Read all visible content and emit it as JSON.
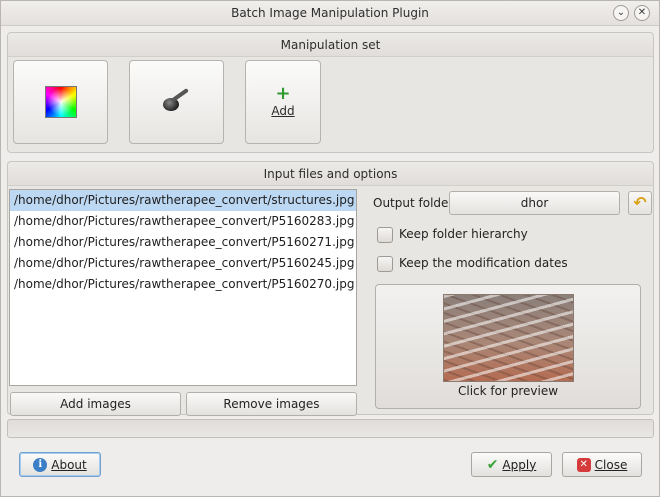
{
  "window": {
    "title": "Batch Image Manipulation Plugin"
  },
  "manipulation_set": {
    "header": "Manipulation set",
    "add_label": "Add"
  },
  "input": {
    "header": "Input files and options",
    "files": [
      "/home/dhor/Pictures/rawtherapee_convert/structures.jpg",
      "/home/dhor/Pictures/rawtherapee_convert/P5160283.jpg",
      "/home/dhor/Pictures/rawtherapee_convert/P5160271.jpg",
      "/home/dhor/Pictures/rawtherapee_convert/P5160245.jpg",
      "/home/dhor/Pictures/rawtherapee_convert/P5160270.jpg"
    ],
    "selected_index": 0,
    "add_images": "Add images",
    "remove_images": "Remove images",
    "output_folder_label": "Output folder",
    "output_folder_value": "dhor",
    "keep_hierarchy": "Keep folder hierarchy",
    "keep_dates": "Keep the modification dates",
    "preview_label": "Click for preview"
  },
  "footer": {
    "about": "About",
    "apply": "Apply",
    "close": "Close"
  },
  "colors": {
    "selection": "#bdd8f2",
    "accent_green": "#39a239",
    "close_red": "#d63b3b"
  }
}
